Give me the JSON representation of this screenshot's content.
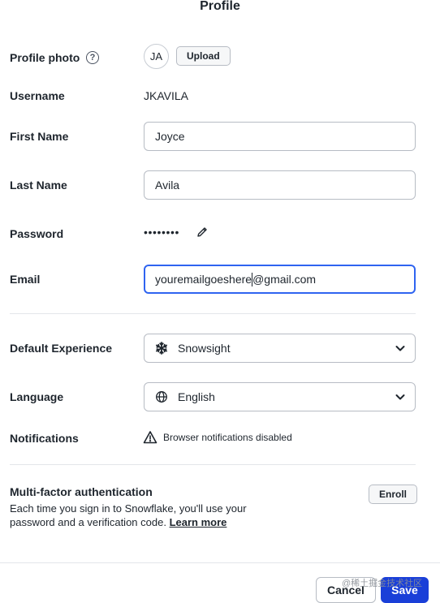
{
  "title": "Profile",
  "profile_photo": {
    "label": "Profile photo",
    "help_glyph": "?",
    "avatar_initials": "JA",
    "upload_label": "Upload"
  },
  "username": {
    "label": "Username",
    "value": "JKAVILA"
  },
  "first_name": {
    "label": "First Name",
    "value": "Joyce"
  },
  "last_name": {
    "label": "Last Name",
    "value": "Avila"
  },
  "password": {
    "label": "Password",
    "value": "••••••••",
    "edit_icon": "pencil-icon"
  },
  "email": {
    "label": "Email",
    "value_before_caret": "youremailgoeshere",
    "value_after_caret": "@gmail.com"
  },
  "default_experience": {
    "label": "Default Experience",
    "value": "Snowsight",
    "icon": "snowflake-icon"
  },
  "language": {
    "label": "Language",
    "value": "English",
    "icon": "globe-icon"
  },
  "notifications": {
    "label": "Notifications",
    "status": "Browser notifications disabled",
    "icon": "warning-icon"
  },
  "mfa": {
    "title": "Multi-factor authentication",
    "description": "Each time you sign in to Snowflake, you'll use your password and a verification code.",
    "link": "Learn more",
    "enroll_label": "Enroll"
  },
  "footer": {
    "cancel_label": "Cancel",
    "save_label": "Save",
    "watermark": "@稀土掘金技术社区"
  },
  "colors": {
    "accent": "#2f64f0",
    "save_bg": "#1a3fd8",
    "text": "#1e252d",
    "border": "#b7bcc4"
  }
}
